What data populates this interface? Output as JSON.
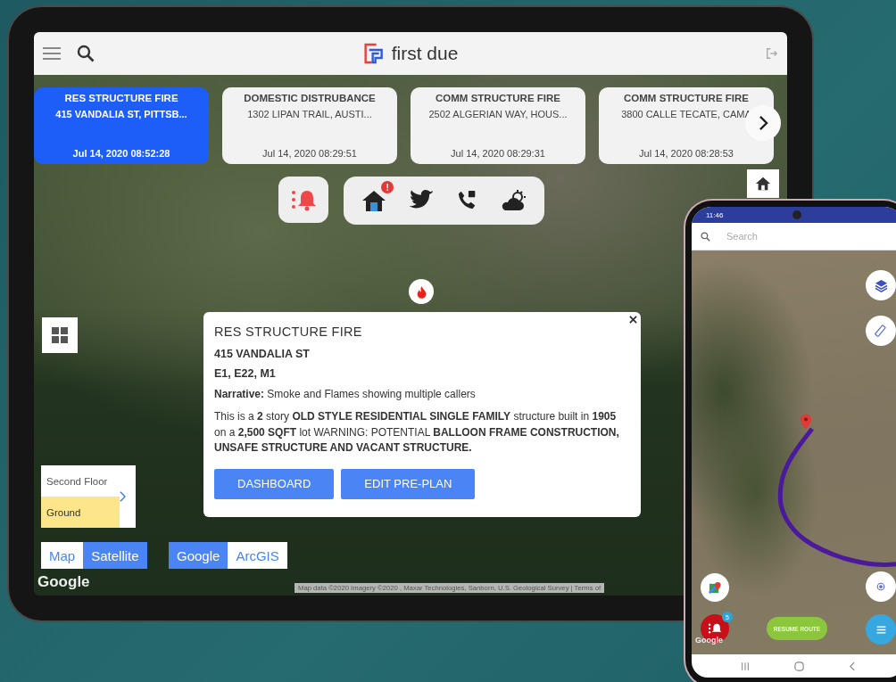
{
  "tablet": {
    "app_title": "first due",
    "incidents": [
      {
        "type": "RES STRUCTURE FIRE",
        "address": "415 VANDALIA ST, PITTSB...",
        "time": "Jul 14, 2020 08:52:28",
        "selected": true
      },
      {
        "type": "DOMESTIC DISTRUBANCE",
        "address": "1302 LIPAN TRAIL, AUSTI...",
        "time": "Jul 14, 2020 08:29:51",
        "selected": false
      },
      {
        "type": "COMM STRUCTURE FIRE",
        "address": "2502 ALGERIAN WAY, HOUS...",
        "time": "Jul 14, 2020 08:29:31",
        "selected": false
      },
      {
        "type": "COMM STRUCTURE FIRE",
        "address": "3800 CALLE TECATE, CAMA",
        "time": "Jul 14, 2020 08:28:53",
        "selected": false
      }
    ],
    "home_badge": "!",
    "popup": {
      "title": "RES STRUCTURE FIRE",
      "address": "415 VANDALIA ST",
      "units": "E1, E22, M1",
      "narrative": "**Narrative:** Smoke and Flames showing multiple callers",
      "description": "This is a **2** story **OLD STYLE RESIDENTIAL SINGLE FAMILY** structure built in **1905** on a **2,500 SQFT** lot WARNING: POTENTIAL **BALLOON FRAME CONSTRUCTION, UNSAFE STRUCTURE AND VACANT STRUCTURE.**",
      "buttons": [
        "DASHBOARD",
        "EDIT PRE-PLAN"
      ]
    },
    "floors": [
      {
        "label": "Second Floor",
        "selected": false
      },
      {
        "label": "Ground",
        "selected": true
      }
    ],
    "map_types": [
      {
        "label": "Map",
        "selected": false
      },
      {
        "label": "Satellite",
        "selected": true
      }
    ],
    "providers": [
      {
        "label": "Google",
        "selected": true
      },
      {
        "label": "ArcGIS",
        "selected": false
      }
    ],
    "map_logo": "Google",
    "attribution": "Map data ©2020 Imagery ©2020 , Maxar Technologies, Sanborn, U.S. Geological Survey | Terms of"
  },
  "phone": {
    "time": "11:46",
    "search": {
      "placeholder": "Search"
    },
    "alert_badge": "5",
    "resume_button": "RESUME ROUTE",
    "map_logo": "Google"
  }
}
